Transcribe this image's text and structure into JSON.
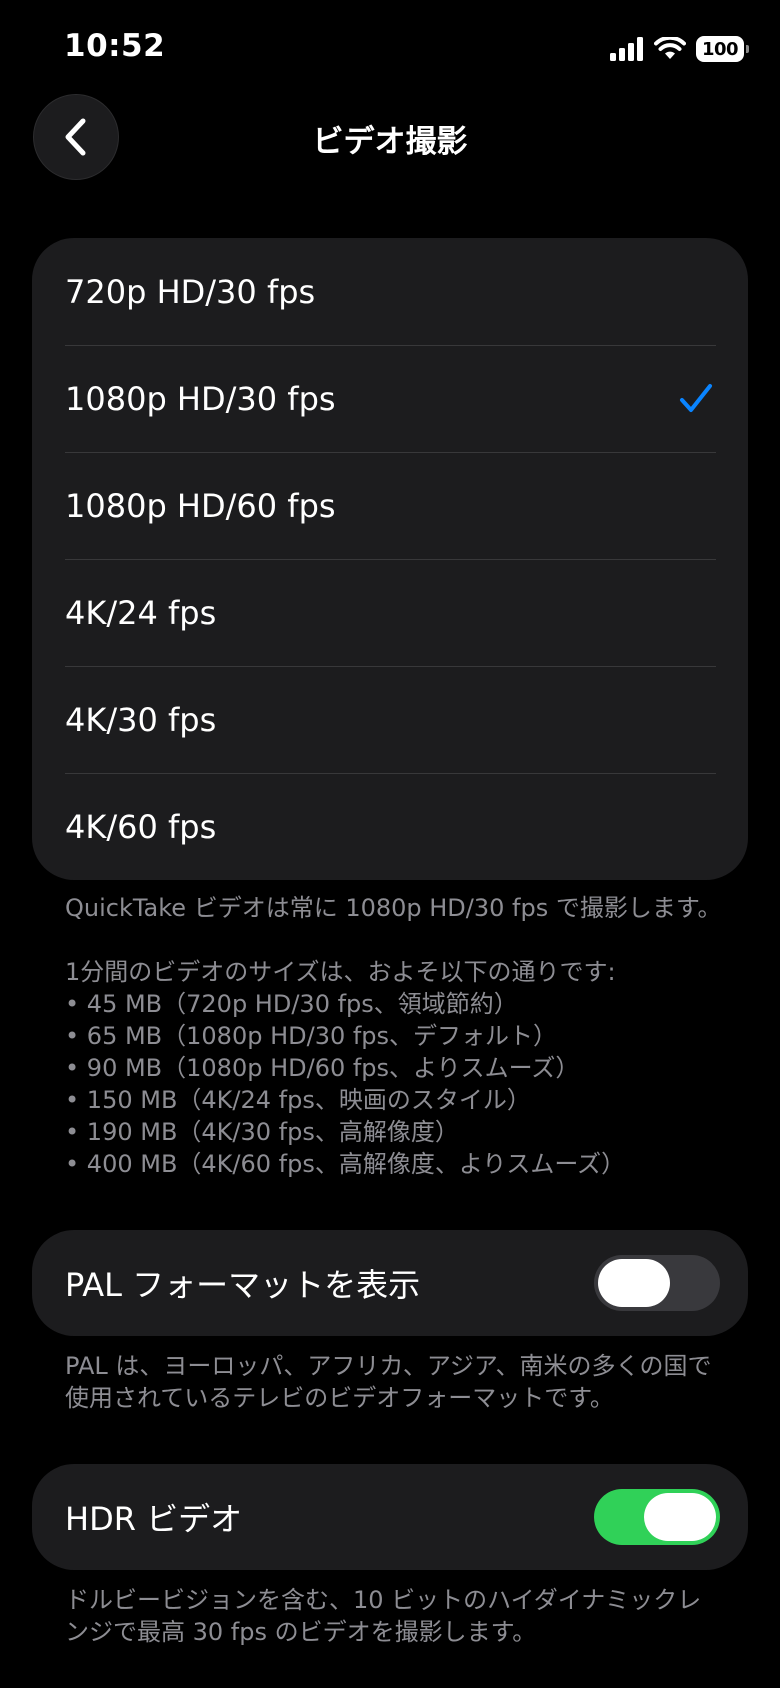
{
  "status_bar": {
    "time": "10:52",
    "battery": "100",
    "icons": [
      "cellular-signal-icon",
      "wifi-icon",
      "battery-icon"
    ]
  },
  "nav": {
    "title": "ビデオ撮影",
    "back_icon": "chevron-left-icon"
  },
  "resolution_options": [
    {
      "label": "720p HD/30 fps",
      "selected": false
    },
    {
      "label": "1080p HD/30 fps",
      "selected": true
    },
    {
      "label": "1080p HD/60 fps",
      "selected": false
    },
    {
      "label": "4K/24 fps",
      "selected": false
    },
    {
      "label": "4K/30 fps",
      "selected": false
    },
    {
      "label": "4K/60 fps",
      "selected": false
    }
  ],
  "quicktake_note": "QuickTake ビデオは常に 1080p HD/30 fps で撮影します。",
  "size_info": {
    "heading": "1分間のビデオのサイズは、およそ以下の通りです:",
    "items": [
      "45 MB（720p HD/30 fps、領域節約）",
      "65 MB（1080p HD/30 fps、デフォルト）",
      "90 MB（1080p HD/60 fps、よりスムーズ）",
      "150 MB（4K/24 fps、映画のスタイル）",
      "190 MB（4K/30 fps、高解像度）",
      "400 MB（4K/60 fps、高解像度、よりスムーズ）"
    ]
  },
  "pal": {
    "label": "PAL フォーマットを表示",
    "on": false,
    "note": "PAL は、ヨーロッパ、アフリカ、アジア、南米の多くの国で使用されているテレビのビデオフォーマットです。"
  },
  "hdr": {
    "label": "HDR ビデオ",
    "on": true,
    "note": "ドルビービジョンを含む、10 ビットのハイダイナミックレンジで最高 30 fps のビデオを撮影します。"
  },
  "colors": {
    "accent_blue": "#0a84ff",
    "toggle_on": "#30d158",
    "toggle_off": "#39393d",
    "cell_background": "#1c1c1e"
  }
}
